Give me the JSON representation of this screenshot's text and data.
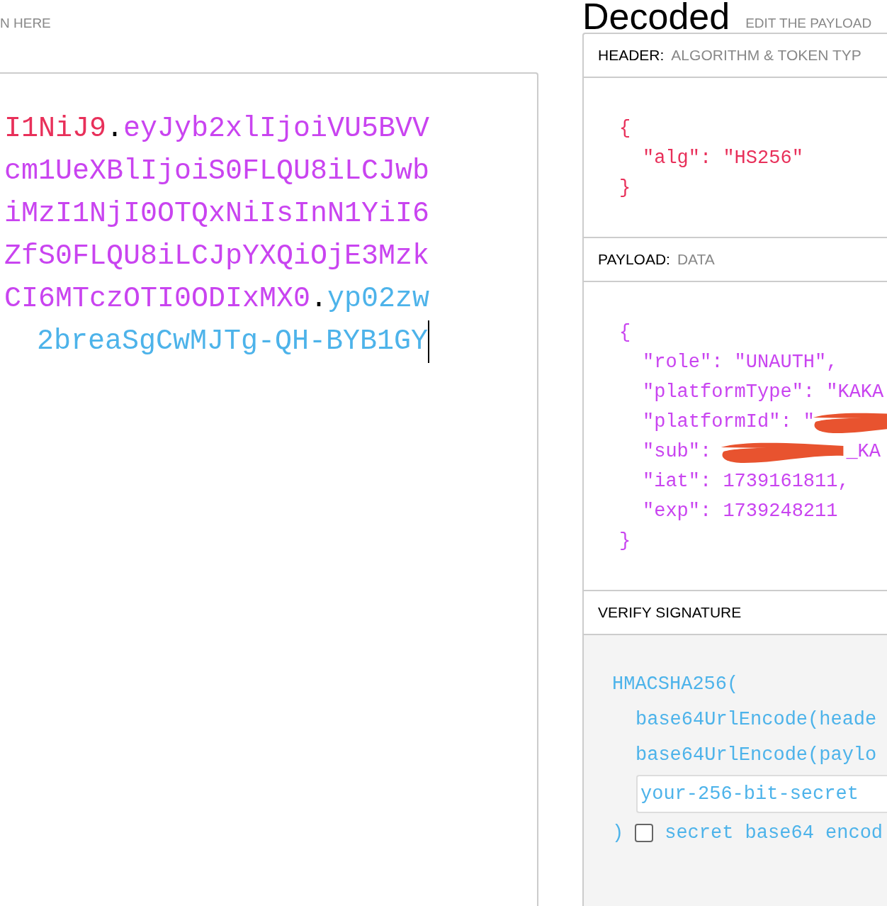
{
  "encoded": {
    "label": "N HERE",
    "focused": true,
    "lines": [
      [
        {
          "kind": "header",
          "text": "I1NiJ9"
        },
        {
          "kind": "dot",
          "text": "."
        },
        {
          "kind": "payload",
          "text": "eyJyb2xlIjoiVU5BVV"
        }
      ],
      [
        {
          "kind": "payload",
          "text": "cm1UeXBlIjoiS0FLQU8iLCJwb"
        }
      ],
      [
        {
          "kind": "payload",
          "text": "iMzI1NjI0OTQxNiIsInN1YiI6"
        }
      ],
      [
        {
          "kind": "payload",
          "text": "ZfS0FLQU8iLCJpYXQiOjE3Mzk"
        }
      ],
      [
        {
          "kind": "payload",
          "text": "CI6MTczOTI0ODIxMX0"
        },
        {
          "kind": "dot",
          "text": "."
        },
        {
          "kind": "signature",
          "text": "yp02zw"
        }
      ],
      [
        {
          "kind": "signature",
          "text": "2breaSgCwMJTg-QH-BYB1GY"
        }
      ]
    ]
  },
  "decoded": {
    "title": "Decoded",
    "hint": "EDIT THE PAYLOAD",
    "sections": [
      {
        "kind": "header",
        "label": "HEADER:",
        "sublabel": "ALGORITHM & TOKEN TYP",
        "open": "{",
        "close": "}",
        "entries": [
          {
            "text": "\"alg\": \"HS256\"",
            "redacted": false
          }
        ]
      },
      {
        "kind": "payload",
        "label": "PAYLOAD:",
        "sublabel": "DATA",
        "open": "{",
        "close": "}",
        "entries": [
          {
            "text": "\"role\": \"UNAUTH\",",
            "redacted": false
          },
          {
            "text": "\"platformType\": \"KAKA",
            "redacted": false
          },
          {
            "text": "\"platformId\": \"",
            "redacted": true
          },
          {
            "text": "\"sub\": ",
            "redacted": true,
            "tail": "_KA"
          },
          {
            "text": "\"iat\": 1739161811,",
            "redacted": false
          },
          {
            "text": "\"exp\": 1739248211",
            "redacted": false
          }
        ]
      },
      {
        "kind": "signature",
        "label": "VERIFY SIGNATURE",
        "open": "HMACSHA256(",
        "close": ")",
        "entries": [
          {
            "text": "base64UrlEncode(heade",
            "redacted": false
          },
          {
            "text": "base64UrlEncode(paylo",
            "redacted": false
          }
        ],
        "secret": {
          "value": "your-256-bit-secret"
        },
        "checkbox": {
          "label": "secret base64 encod",
          "checked": false
        }
      }
    ]
  }
}
